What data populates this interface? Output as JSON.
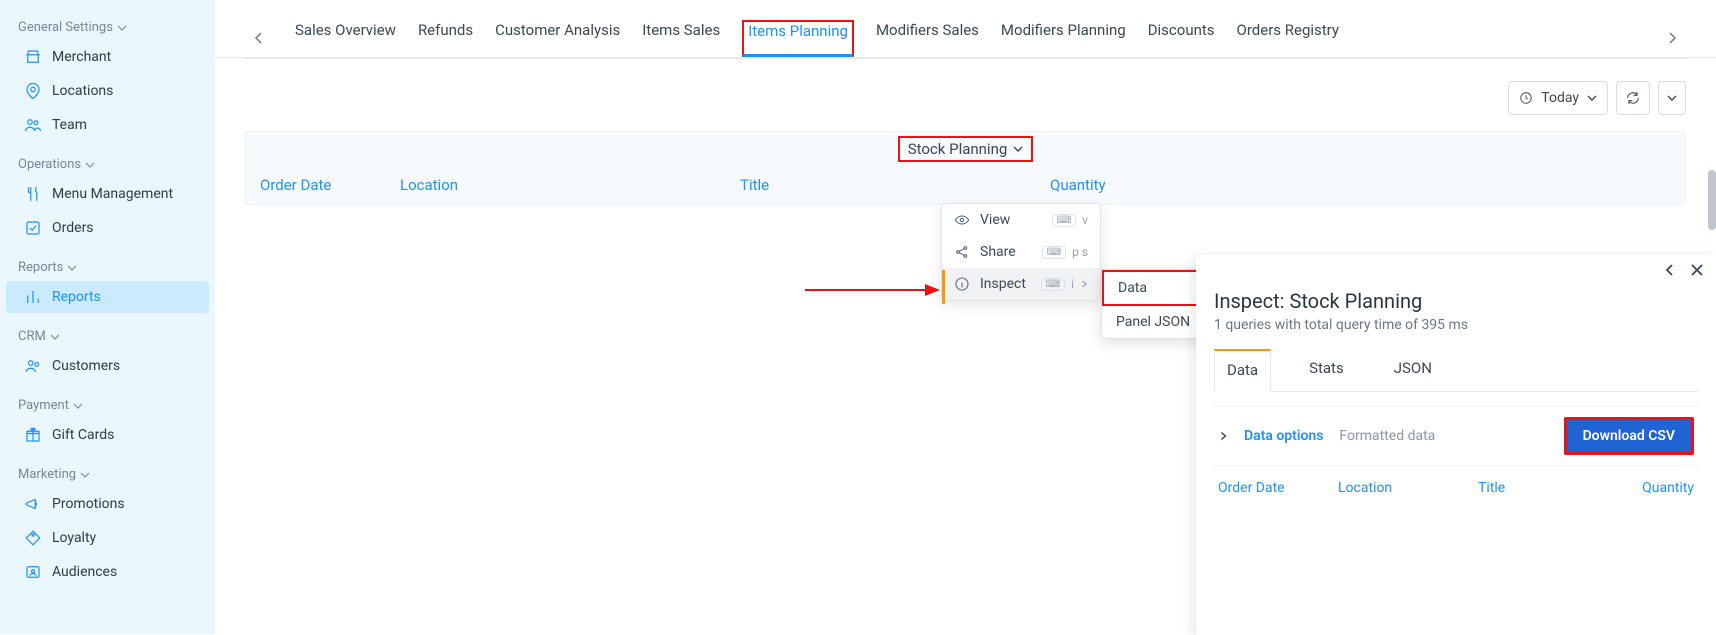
{
  "sidebar": {
    "sections": [
      {
        "title": "General Settings",
        "items": [
          {
            "icon": "storefront",
            "label": "Merchant"
          },
          {
            "icon": "pin",
            "label": "Locations"
          },
          {
            "icon": "team",
            "label": "Team"
          }
        ]
      },
      {
        "title": "Operations",
        "items": [
          {
            "icon": "utensils",
            "label": "Menu Management"
          },
          {
            "icon": "check-square",
            "label": "Orders"
          }
        ]
      },
      {
        "title": "Reports",
        "items": [
          {
            "icon": "bar-chart",
            "label": "Reports",
            "active": true
          }
        ]
      },
      {
        "title": "CRM",
        "items": [
          {
            "icon": "users",
            "label": "Customers"
          }
        ]
      },
      {
        "title": "Payment",
        "items": [
          {
            "icon": "gift",
            "label": "Gift Cards"
          }
        ]
      },
      {
        "title": "Marketing",
        "items": [
          {
            "icon": "megaphone",
            "label": "Promotions"
          },
          {
            "icon": "tag",
            "label": "Loyalty"
          },
          {
            "icon": "audience",
            "label": "Audiences"
          }
        ]
      }
    ]
  },
  "tabs": [
    "Sales Overview",
    "Refunds",
    "Customer Analysis",
    "Items Sales",
    "Items Planning",
    "Modifiers Sales",
    "Modifiers Planning",
    "Discounts",
    "Orders Registry"
  ],
  "active_tab_index": 4,
  "toolbar": {
    "range_label": "Today"
  },
  "panel": {
    "title": "Stock Planning",
    "columns": [
      "Order Date",
      "Location",
      "Title",
      "Quantity"
    ]
  },
  "context_menu": {
    "items": [
      {
        "icon": "eye",
        "label": "View",
        "shortcut": "v"
      },
      {
        "icon": "share",
        "label": "Share",
        "shortcut": "p s"
      },
      {
        "icon": "info",
        "label": "Inspect",
        "shortcut": "i",
        "has_submenu": true,
        "hover": true
      }
    ]
  },
  "submenu": {
    "items": [
      "Data",
      "Panel JSON"
    ],
    "highlighted_index": 0
  },
  "drawer": {
    "title": "Inspect: Stock Planning",
    "subtitle": "1 queries with total query time of 395 ms",
    "tabs": [
      "Data",
      "Stats",
      "JSON"
    ],
    "active_tab": 0,
    "options_label": "Data options",
    "options_status": "Formatted data",
    "download_label": "Download CSV",
    "columns": [
      "Order Date",
      "Location",
      "Title",
      "Quantity"
    ]
  }
}
